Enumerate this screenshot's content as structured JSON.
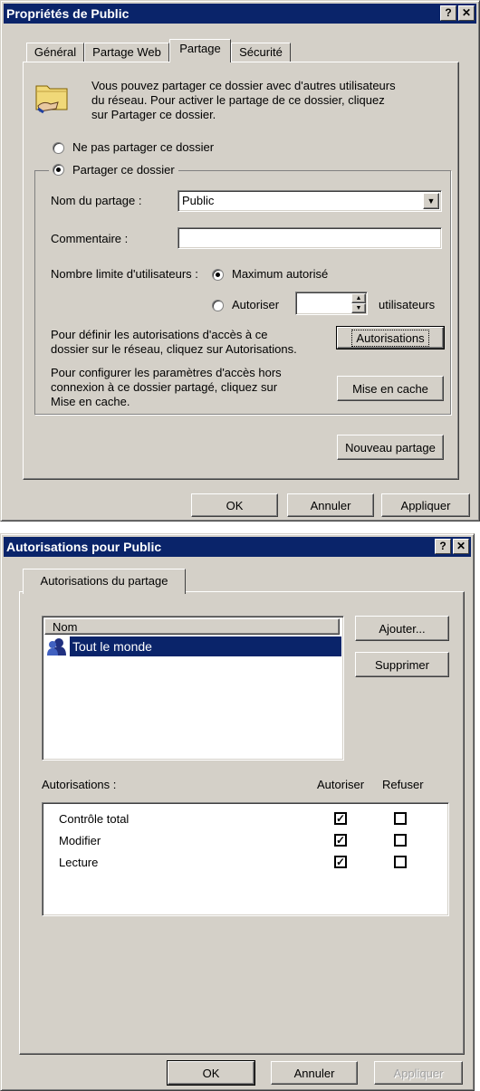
{
  "dialog1": {
    "title": "Propriétés de Public",
    "help_btn": "?",
    "close_btn": "✕",
    "tabs": [
      "Général",
      "Partage Web",
      "Partage",
      "Sécurité"
    ],
    "intro_line1": "Vous pouvez partager ce dossier avec d'autres utilisateurs",
    "intro_line2": "du réseau. Pour activer le partage de ce dossier, cliquez",
    "intro_line3": "sur Partager ce dossier.",
    "radio_no_share": "Ne pas partager ce dossier",
    "radio_share": "Partager ce dossier",
    "share_name_label": "Nom du partage :",
    "share_name_value": "Public",
    "comment_label": "Commentaire :",
    "comment_value": "",
    "user_limit_label": "Nombre limite d'utilisateurs :",
    "max_allowed": "Maximum autorisé",
    "allow": "Autoriser",
    "users_label": "utilisateurs",
    "perm_text1": "Pour définir les autorisations d'accès à ce",
    "perm_text2": "dossier sur le réseau, cliquez sur Autorisations.",
    "perm_button": "Autorisations",
    "cache_text1": "Pour configurer les paramètres d'accès hors",
    "cache_text2": "connexion à ce dossier partagé, cliquez sur",
    "cache_text3": "Mise en cache.",
    "cache_button": "Mise en cache",
    "new_share_button": "Nouveau partage",
    "ok": "OK",
    "cancel": "Annuler",
    "apply": "Appliquer"
  },
  "dialog2": {
    "title": "Autorisations pour Public",
    "help_btn": "?",
    "close_btn": "✕",
    "tab": "Autorisations du partage",
    "col_name": "Nom",
    "users": [
      "Tout le monde"
    ],
    "add_button": "Ajouter...",
    "remove_button": "Supprimer",
    "perm_label": "Autorisations :",
    "col_allow": "Autoriser",
    "col_deny": "Refuser",
    "permissions": [
      {
        "name": "Contrôle total",
        "allow": true,
        "deny": false
      },
      {
        "name": "Modifier",
        "allow": true,
        "deny": false
      },
      {
        "name": "Lecture",
        "allow": true,
        "deny": false
      }
    ],
    "ok": "OK",
    "cancel": "Annuler",
    "apply": "Appliquer"
  }
}
